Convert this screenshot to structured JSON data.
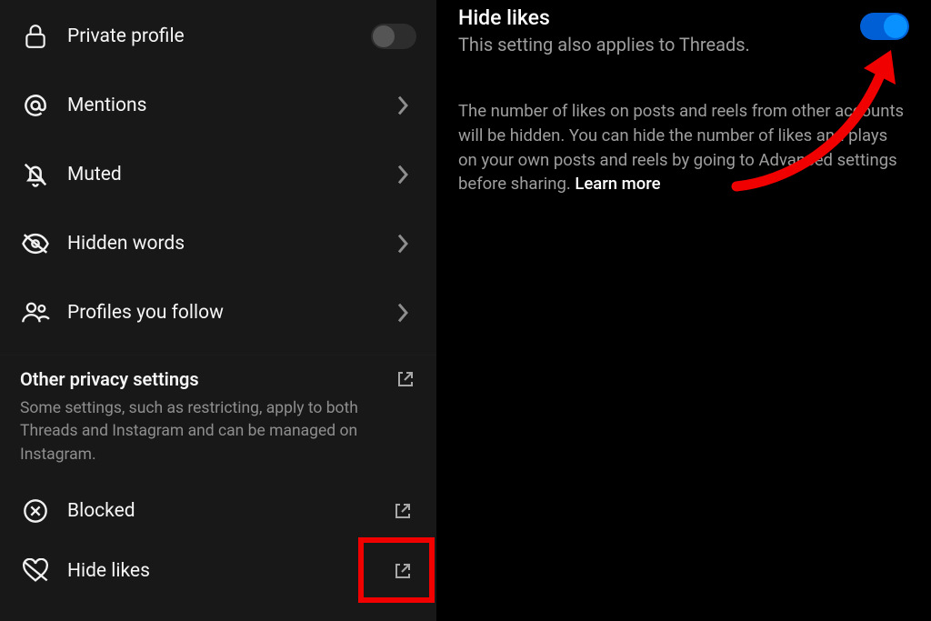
{
  "left": {
    "items": [
      {
        "label": "Private profile"
      },
      {
        "label": "Mentions"
      },
      {
        "label": "Muted"
      },
      {
        "label": "Hidden words"
      },
      {
        "label": "Profiles you follow"
      }
    ],
    "section": {
      "title": "Other privacy settings",
      "desc": "Some settings, such as restricting, apply to both Threads and Instagram and can be managed on Instagram."
    },
    "ext_items": [
      {
        "label": "Blocked"
      },
      {
        "label": "Hide likes"
      }
    ]
  },
  "right": {
    "title": "Hide likes",
    "subtitle": "This setting also applies to Threads.",
    "body": "The number of likes on posts and reels from other accounts will be hidden. You can hide the number of likes and plays on your own posts and reels by going to Advanced settings before sharing. ",
    "learn_more": "Learn more"
  }
}
